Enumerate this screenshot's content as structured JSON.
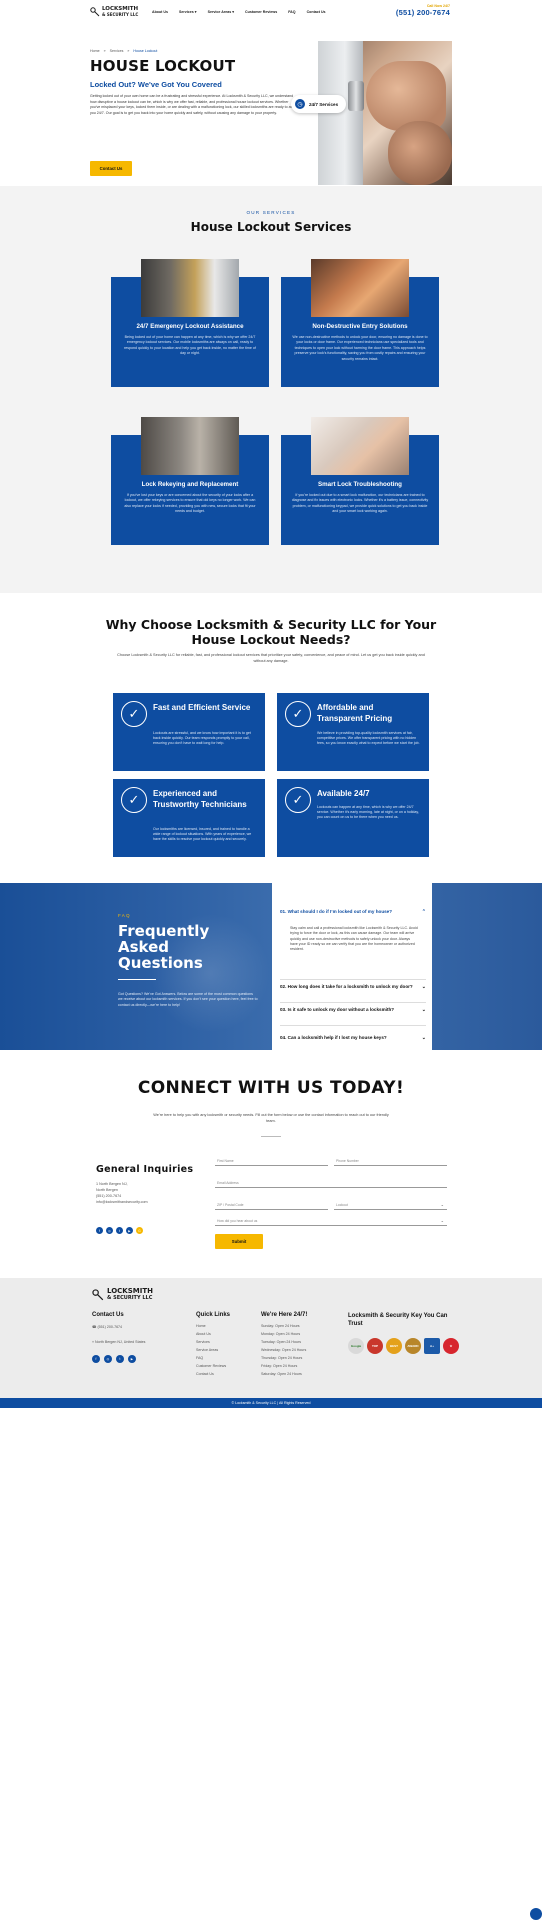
{
  "header": {
    "logo_line1": "LOCKSMITH",
    "logo_line2": "& SECURITY LLC",
    "nav": [
      "About Us",
      "Services ▾",
      "Service Areas ▾",
      "Customer Reviews",
      "FAQ",
      "Contact Us"
    ],
    "call_label": "Call Now 24/7",
    "phone": "(551) 200-7674"
  },
  "hero": {
    "breadcrumb": [
      "Home",
      "Services",
      "House Lockout"
    ],
    "title": "HOUSE LOCKOUT",
    "subtitle": "Locked Out? We've Got You Covered",
    "body": "Getting locked out of your own home can be a frustrating and stressful experience. At Locksmith & Security LLC, we understand how disruptive a house lockout can be, which is why we offer fast, reliable, and professional house lockout services. Whether you've misplaced your keys, locked them inside, or are dealing with a malfunctioning lock, our skilled locksmiths are ready to assist you 24/7. Our goal is to get you back into your home quickly and safely, without causing any damage to your property.",
    "cta": "Contact Us",
    "badge": "24/7 Services"
  },
  "services": {
    "eyebrow": "OUR SERVICES",
    "title": "House Lockout Services",
    "cards": [
      {
        "title": "24/7 Emergency Lockout Assistance",
        "body": "Being locked out of your home can happen at any time, which is why we offer 24/7 emergency lockout services. Our mobile locksmiths are always on call, ready to respond quickly to your location and help you get back inside, no matter the time of day or night."
      },
      {
        "title": "Non-Destructive Entry Solutions",
        "body": "We use non-destructive methods to unlock your door, ensuring no damage is done to your locks or door frame. Our experienced technicians use specialized tools and techniques to open your lock without harming the door frame. This approach helps preserve your lock’s functionality, saving you from costly repairs and ensuring your security remains intact."
      },
      {
        "title": "Lock Rekeying and Replacement",
        "body": "If you’ve lost your keys or are concerned about the security of your locks after a lockout, we offer rekeying services to ensure that old keys no longer work. We can also replace your locks if needed, providing you with new, secure locks that fit your needs and budget."
      },
      {
        "title": "Smart Lock Troubleshooting",
        "body": "If you’re locked out due to a smart lock malfunction, our technicians are trained to diagnose and fix issues with electronic locks. Whether it’s a battery issue, connectivity problem, or malfunctioning keypad, we provide quick solutions to get you back inside and your smart lock working again."
      }
    ]
  },
  "why": {
    "title": "Why Choose Locksmith & Security LLC for Your House Lockout Needs?",
    "subtitle": "Choose Locksmith & Security LLC for reliable, fast, and professional lockout services that prioritize your safety, convenience, and peace of mind. Let us get you back inside quickly and without any damage.",
    "cards": [
      {
        "title": "Fast and Efficient Service",
        "body": "Lockouts are stressful, and we know how important it is to get back inside quickly. Our team responds promptly to your call, ensuring you don’t have to wait long for help."
      },
      {
        "title": "Affordable and Transparent Pricing",
        "body": "We believe in providing top-quality locksmith services at fair, competitive prices. We offer transparent pricing with no hidden fees, so you know exactly what to expect before we start the job."
      },
      {
        "title": "Experienced and Trustworthy Technicians",
        "body": "Our locksmiths are licensed, insured, and trained to handle a wide range of lockout situations. With years of experience, we have the skills to resolve your lockout quickly and securely."
      },
      {
        "title": "Available 24/7",
        "body": "Lockouts can happen at any time, which is why we offer 24/7 service. Whether it’s early morning, late at night, or on a holiday, you can count on us to be there when you need us."
      }
    ]
  },
  "faq": {
    "eyebrow": "FAQ",
    "title_lines": [
      "Frequently",
      "Asked",
      "Questions"
    ],
    "intro": "Got Questions? We’ve Got Answers. Below are some of the most common questions we receive about our locksmith services. If you don’t see your question here, feel free to contact us directly—we’re here to help!",
    "items": [
      {
        "q": "01. What should I do if I’m locked out of my house?",
        "a": "Stay calm and call a professional locksmith like Locksmith & Security LLC. Avoid trying to force the door or lock, as this can cause damage. Our team will arrive quickly and use non-destructive methods to safely unlock your door. Always have your ID ready so we can verify that you are the homeowner or authorized resident."
      },
      {
        "q": "02. How long does it take for a locksmith to unlock my door?",
        "a": ""
      },
      {
        "q": "03. Is it safe to unlock my door without a locksmith?",
        "a": ""
      },
      {
        "q": "04. Can a locksmith help if I lost my house keys?",
        "a": ""
      }
    ]
  },
  "contact": {
    "title": "CONNECT WITH US TODAY!",
    "subtitle": "We’re here to help you with any locksmith or security needs. Fill out the form below or use the contact information to reach out to our friendly team.",
    "general_title": "General Inquiries",
    "address_lines": [
      "1 North Bergen NJ,",
      "North Bergen",
      "(551) 200-7674",
      "info@locksmithandsecurity.com"
    ],
    "fields": {
      "first": "First Name",
      "phone": "Phone Number",
      "email": "Email Address",
      "zip": "ZIP / Postal Code",
      "service": "Lockout",
      "message": "How did you hear about us"
    },
    "submit": "Submit"
  },
  "footer": {
    "contact_title": "Contact Us",
    "phone": "(551) 200-7674",
    "address": "North Bergen NJ, United States",
    "quick_title": "Quick Links",
    "quick_links": [
      "Home",
      "About Us",
      "Services",
      "Service Areas",
      "FAQ",
      "Customer Reviews",
      "Contact Us"
    ],
    "hours_title": "We're Here 24/7!",
    "hours": [
      "Sunday: Open 24 Hours",
      "Monday: Open 24 Hours",
      "Tuesday: Open 24 Hours",
      "Wednesday: Open 24 Hours",
      "Thursday: Open 24 Hours",
      "Friday: Open 24 Hours",
      "Saturday: Open 24 Hours"
    ],
    "trust_title": "Locksmith & Security Key You Can Trust",
    "seal_labels": [
      "Google",
      "TOP",
      "BEST",
      "AWARD",
      "A+",
      "★"
    ],
    "copyright": "© Locksmith & Security LLC | All Rights Reserved"
  }
}
